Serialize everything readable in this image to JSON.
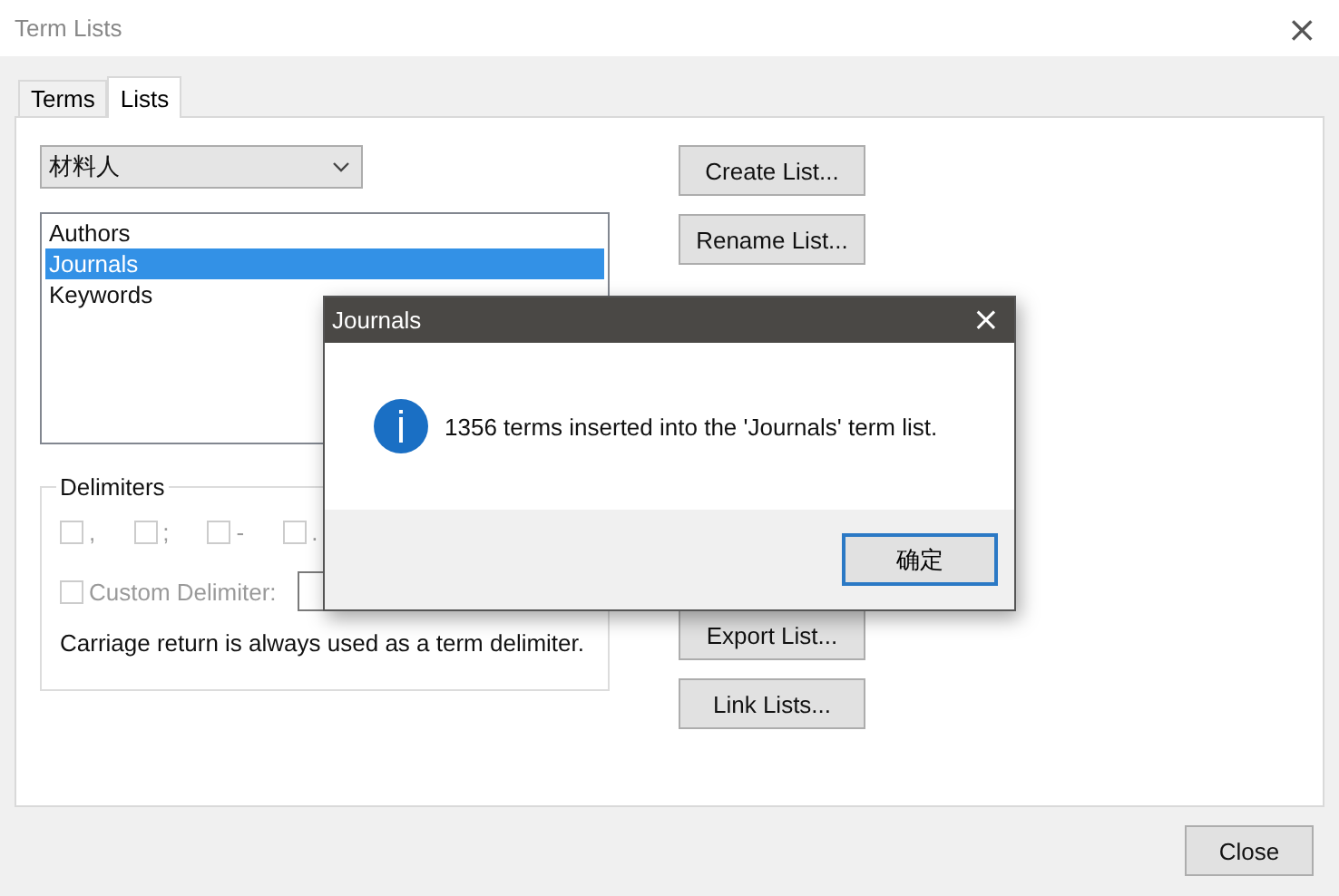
{
  "window": {
    "title": "Term Lists",
    "close": "×"
  },
  "tabs": [
    {
      "label": "Terms",
      "selected": false
    },
    {
      "label": "Lists",
      "selected": true
    }
  ],
  "library_select": {
    "value": "材料人"
  },
  "term_lists": [
    {
      "label": "Authors",
      "selected": false
    },
    {
      "label": "Journals",
      "selected": true
    },
    {
      "label": "Keywords",
      "selected": false
    }
  ],
  "delimiters": {
    "title": "Delimiters",
    "options": [
      {
        "label": ",",
        "checked": false
      },
      {
        "label": ";",
        "checked": false
      },
      {
        "label": "-",
        "checked": false
      },
      {
        "label": ".",
        "checked": false
      }
    ],
    "custom": {
      "label": "Custom Delimiter:",
      "checked": false
    },
    "note": "Carriage return is always used as a term delimiter.",
    "disabled": true
  },
  "actions": [
    {
      "label": "Create List..."
    },
    {
      "label": "Rename List..."
    },
    {
      "label": "Export List..."
    },
    {
      "label": "Link Lists..."
    }
  ],
  "close_button": "Close",
  "message_dialog": {
    "title": "Journals",
    "close": "×",
    "message": "1356 terms inserted into the 'Journals' term list.",
    "ok_button": "确定"
  }
}
